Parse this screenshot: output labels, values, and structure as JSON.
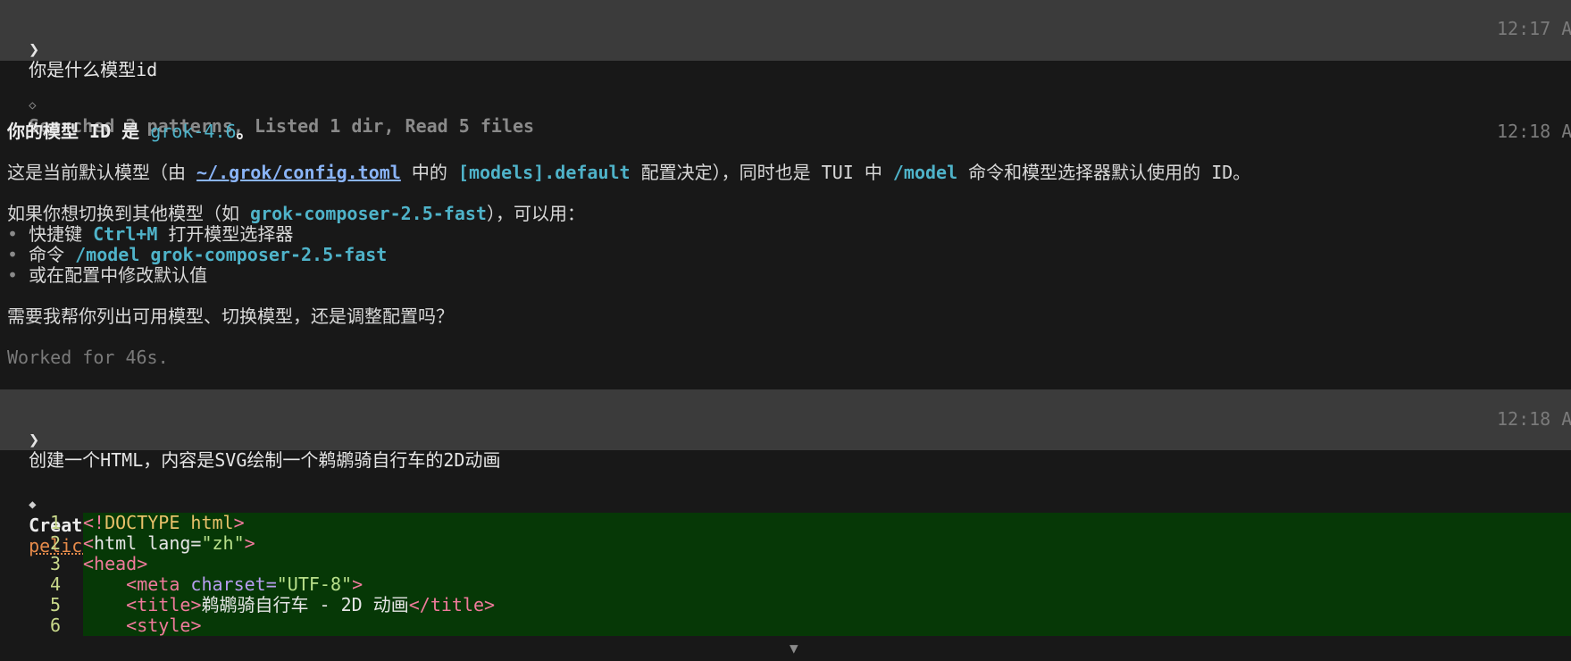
{
  "turn1": {
    "prompt": "你是什么模型id",
    "timestamp": "12:17 A"
  },
  "response1": {
    "tools_summary": "Searched 2 patterns, Listed 1 dir, Read 5 files",
    "heading_pre": "你的模型 ID 是 ",
    "model_id": "grok-4.6",
    "heading_post": "。",
    "timestamp": "12:18 A",
    "line2_a": "这是当前默认模型（由 ",
    "line2_path": "~/.grok/config.toml",
    "line2_b": " 中的 ",
    "line2_key": "[models].default",
    "line2_c": " 配置决定），同时也是 TUI 中 ",
    "line2_cmd": "/model",
    "line2_d": " 命令和模型选择器默认使用的 ID。",
    "line3_a": "如果你想切换到其他模型（如 ",
    "line3_model": "grok-composer-2.5-fast",
    "line3_b": "），可以用：",
    "bullet_char": "•",
    "b1_a": " 快捷键 ",
    "b1_key": "Ctrl+M",
    "b1_b": " 打开模型选择器",
    "b2_a": " 命令 ",
    "b2_cmd": "/model grok-composer-2.5-fast",
    "b3": " 或在配置中修改默认值",
    "question": "需要我帮你列出可用模型、切换模型，还是调整配置吗？",
    "worked": "Worked for 46s."
  },
  "turn2": {
    "prompt": "创建一个HTML，内容是SVG绘制一个鹈鹕骑自行车的2D动画",
    "timestamp": "12:18 A"
  },
  "creating": {
    "label": "Creating",
    "filename": "pelican-bike.html"
  },
  "code": {
    "l1": {
      "n": "1",
      "a": "<!",
      "b": "DOCTYPE html",
      "c": ">"
    },
    "l2": {
      "n": "2",
      "a": "<",
      "b": "html",
      "c": " lang=",
      "d": "\"zh\"",
      "e": ">"
    },
    "l3": {
      "n": "3",
      "a": "<",
      "b": "head",
      "c": ">"
    },
    "l4": {
      "n": "4",
      "a": "    <",
      "b": "meta",
      "c": " charset=",
      "d": "\"UTF-8\"",
      "e": ">"
    },
    "l5": {
      "n": "5",
      "a": "    <",
      "b": "title",
      "c": ">",
      "d": "鹈鹕骑自行车 - 2D 动画",
      "e": "</",
      "f": "title",
      "g": ">"
    },
    "l6": {
      "n": "6",
      "a": "    <",
      "b": "style",
      "c": ">"
    }
  },
  "icons": {
    "prompt": "chevron-right-icon",
    "tools": "diamond-outline-icon",
    "creating": "diamond-filled-icon",
    "scroll": "triangle-down-icon"
  },
  "colors": {
    "prompt_bar": "#3b3b3b",
    "background": "#181818",
    "code_added_bg": "#063806",
    "accent_cyan": "#4fb3c9",
    "file_orange": "#e58a4a"
  }
}
